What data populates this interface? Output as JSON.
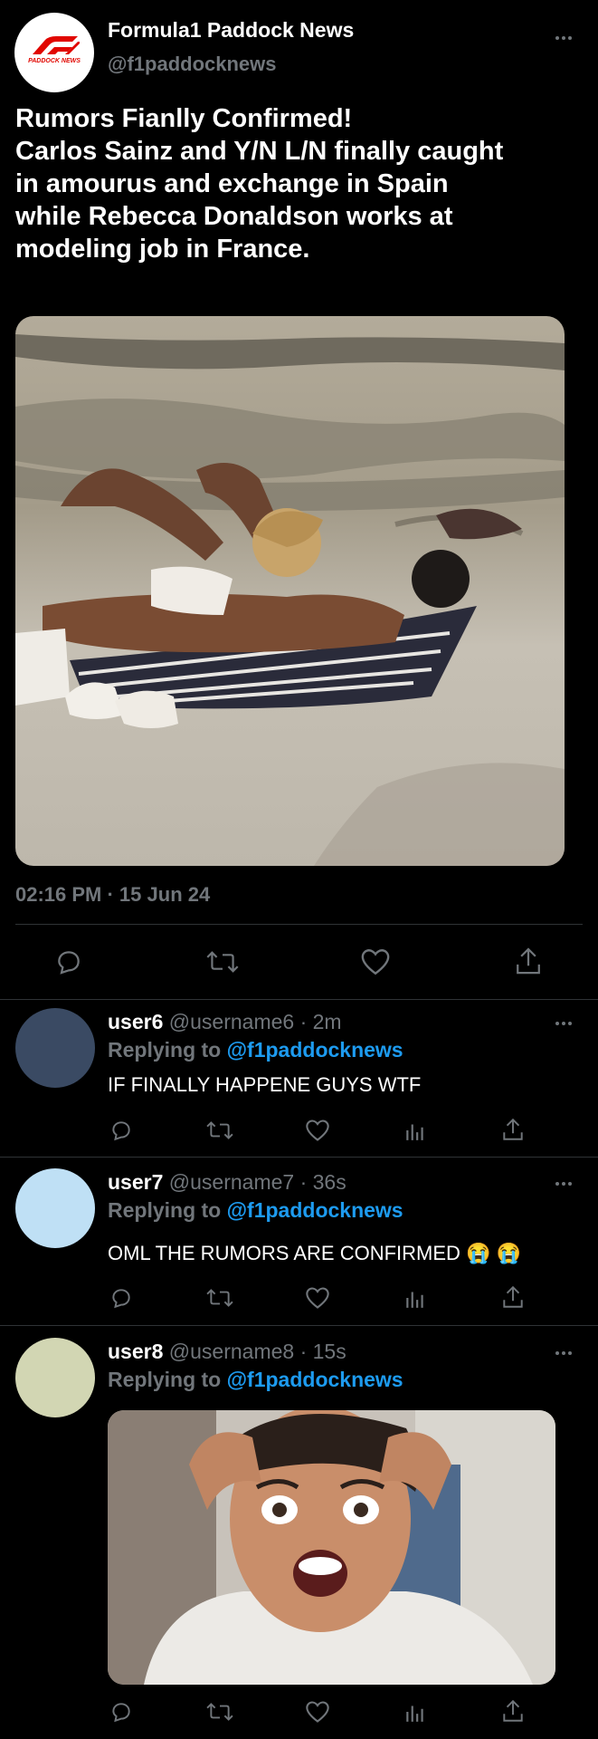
{
  "tweet": {
    "author_name": "Formula1 Paddock News",
    "author_handle": "@f1paddocknews",
    "logo_text": "PADDOCK NEWS",
    "body_lines": [
      "Rumors Fianlly Confirmed!",
      "Carlos Sainz and Y/N L/N finally caught",
      "in amourus and exchange in Spain",
      "while Rebecca Donaldson works at",
      "modeling job in France."
    ],
    "timestamp": "02:16 PM · 15 Jun 24"
  },
  "replies": [
    {
      "name": "user6",
      "handle": "@username6",
      "time": "2m",
      "replying_prefix": "Replying to ",
      "replying_to": "@f1paddocknews",
      "text": "IF FINALLY HAPPENE GUYS WTF",
      "avatar_color": "#3a4a63"
    },
    {
      "name": "user7",
      "handle": "@username7",
      "time": "36s",
      "replying_prefix": "Replying to ",
      "replying_to": "@f1paddocknews",
      "text": "OML THE RUMORS ARE CONFIRMED 😭 😭",
      "avatar_color": "#bfe0f5"
    },
    {
      "name": "user8",
      "handle": "@username8",
      "time": "15s",
      "replying_prefix": "Replying to ",
      "replying_to": "@f1paddocknews",
      "text": "",
      "avatar_color": "#d2d6b3"
    }
  ],
  "icons": {
    "reply": "reply-icon",
    "retweet": "retweet-icon",
    "like": "heart-icon",
    "share": "share-icon",
    "views": "analytics-icon",
    "more": "more-icon"
  },
  "colors": {
    "background": "#000000",
    "accent": "#1d9bf0",
    "logo_red": "#e10600",
    "muted": "#71767b",
    "divider": "#2f3336"
  }
}
